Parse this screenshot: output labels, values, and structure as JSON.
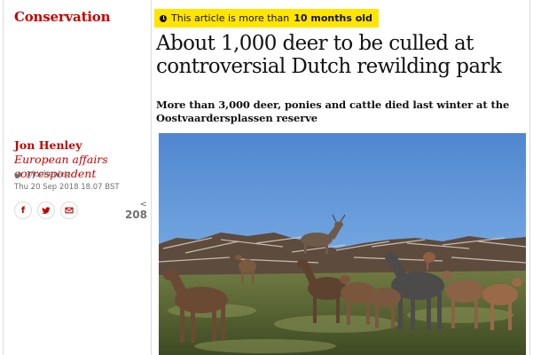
{
  "section": {
    "label": "Conservation"
  },
  "age_banner": {
    "prefix": "This article is more than",
    "age": "10 months old",
    "icon": "clock-icon"
  },
  "article": {
    "headline": "About 1,000 deer to be culled at controversial Dutch rewilding park",
    "standfirst": "More than 3,000 deer, ponies and cattle died last winter at the Oostvaardersplassen reserve"
  },
  "byline": {
    "author": "Jon Henley",
    "role": "European affairs correspondent",
    "twitter": "@jonhenley",
    "date": "Thu 20 Sep 2018 18.07 BST"
  },
  "share": {
    "facebook_label": "f",
    "count": "208",
    "icons": [
      "facebook-icon",
      "twitter-icon",
      "email-icon",
      "share-icon"
    ]
  },
  "colors": {
    "accent": "#c70000",
    "banner": "#ffe500",
    "text": "#121212",
    "muted": "#707070"
  }
}
